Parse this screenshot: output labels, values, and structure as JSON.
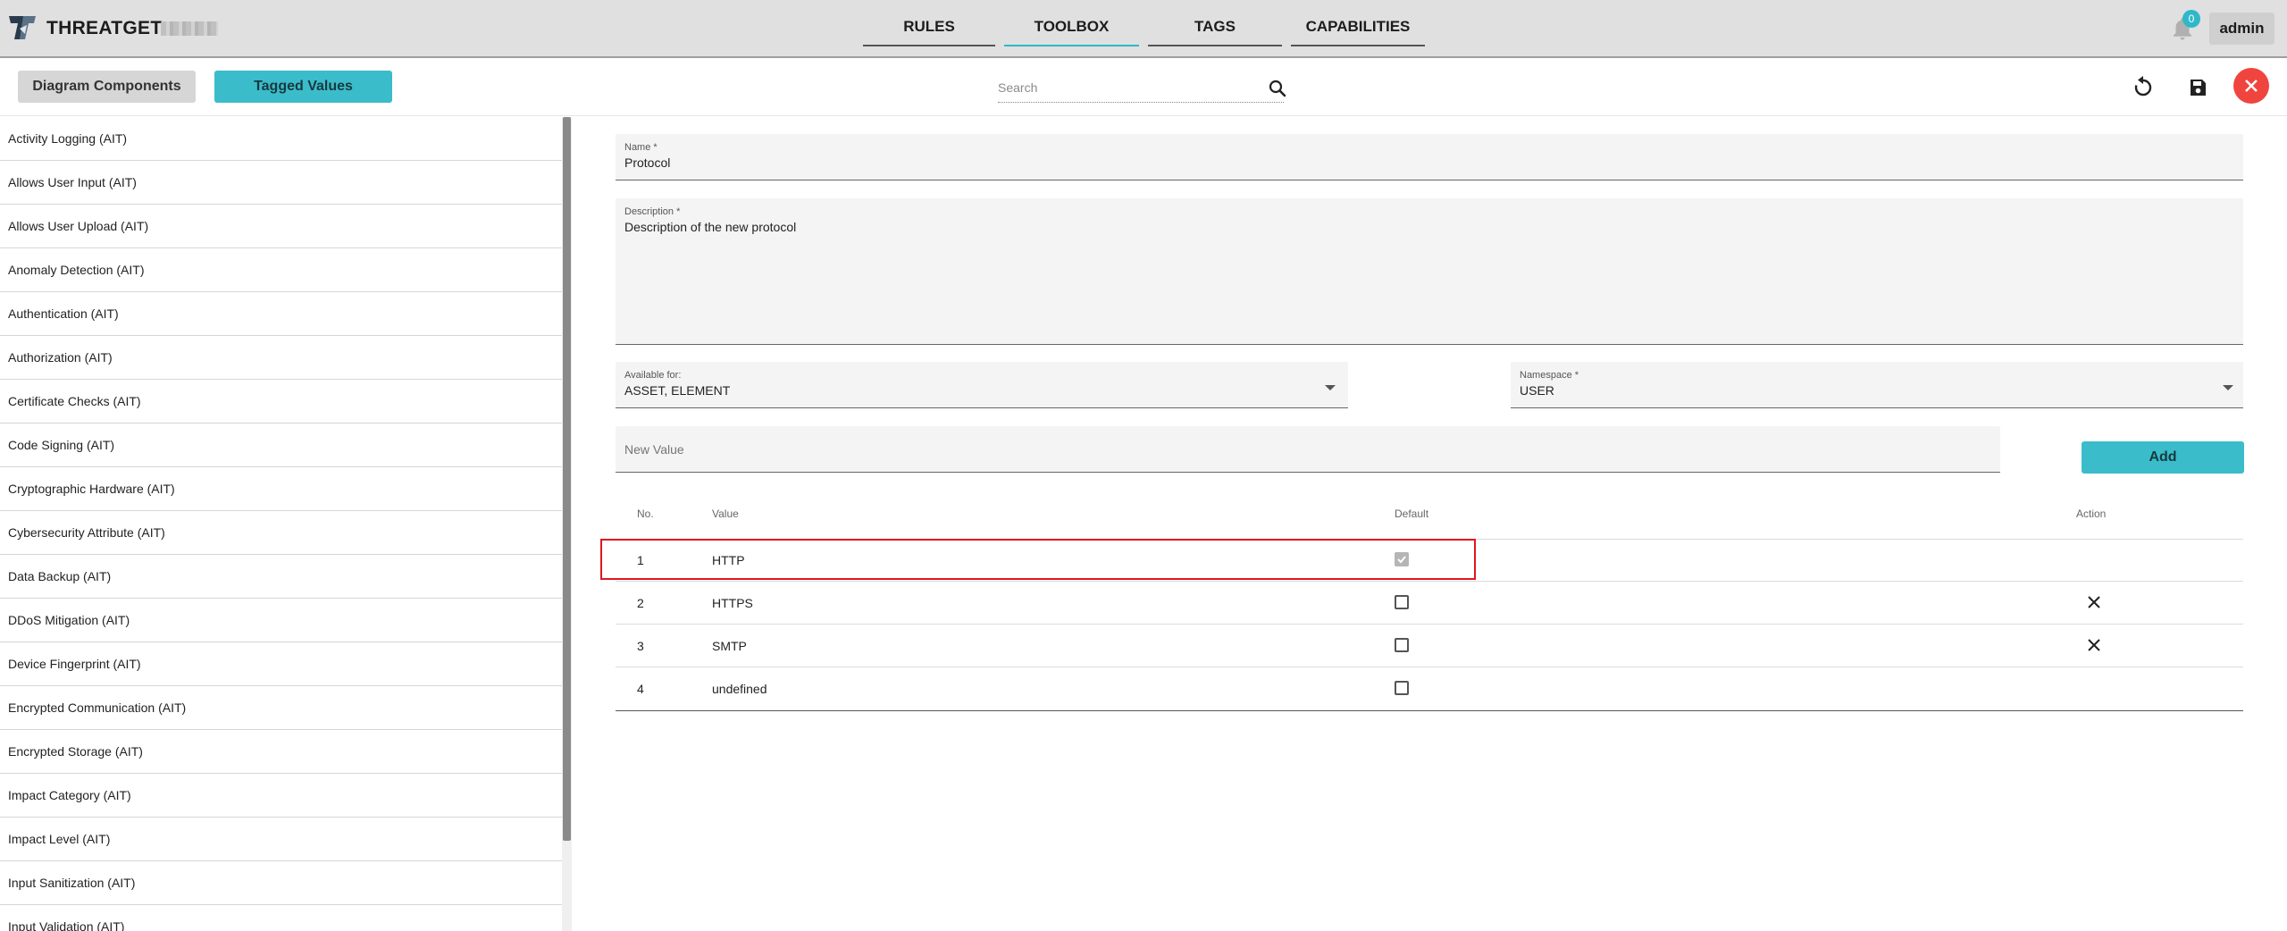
{
  "app": {
    "brand": "THREATGET",
    "notifications_count": "0",
    "user_label": "admin"
  },
  "nav": {
    "tabs": [
      {
        "label": "RULES"
      },
      {
        "label": "TOOLBOX",
        "active": true
      },
      {
        "label": "TAGS"
      },
      {
        "label": "CAPABILITIES"
      }
    ]
  },
  "toolbar": {
    "diagram_components_label": "Diagram Components",
    "tagged_values_label": "Tagged Values",
    "search_placeholder": "Search"
  },
  "sidebar": {
    "items": [
      "Activity Logging (AIT)",
      "Allows User Input (AIT)",
      "Allows User Upload (AIT)",
      "Anomaly Detection (AIT)",
      "Authentication (AIT)",
      "Authorization (AIT)",
      "Certificate Checks (AIT)",
      "Code Signing (AIT)",
      "Cryptographic Hardware (AIT)",
      "Cybersecurity Attribute (AIT)",
      "Data Backup (AIT)",
      "DDoS Mitigation (AIT)",
      "Device Fingerprint (AIT)",
      "Encrypted Communication (AIT)",
      "Encrypted Storage (AIT)",
      "Impact Category (AIT)",
      "Impact Level (AIT)",
      "Input Sanitization (AIT)",
      "Input Validation (AIT)"
    ]
  },
  "form": {
    "name": {
      "label": "Name *",
      "value": "Protocol"
    },
    "description": {
      "label": "Description *",
      "value": "Description of the new protocol"
    },
    "available_for": {
      "label": "Available for:",
      "value": "ASSET, ELEMENT"
    },
    "namespace": {
      "label": "Namespace *",
      "value": "USER"
    },
    "new_value": {
      "placeholder": "New Value"
    },
    "add_label": "Add"
  },
  "table": {
    "headers": {
      "no": "No.",
      "value": "Value",
      "default": "Default",
      "action": "Action"
    },
    "rows": [
      {
        "no": "1",
        "value": "HTTP",
        "default": true,
        "deletable": false
      },
      {
        "no": "2",
        "value": "HTTPS",
        "default": false,
        "deletable": true
      },
      {
        "no": "3",
        "value": "SMTP",
        "default": false,
        "deletable": true
      },
      {
        "no": "4",
        "value": "undefined",
        "default": false,
        "deletable": false
      }
    ]
  },
  "colors": {
    "accent": "#3bbcca",
    "close_button": "#f0443f",
    "highlight_border": "#e0161e"
  },
  "icons": {
    "logo": "threatget-logo-icon",
    "notifications": "bell-icon",
    "search": "search-icon",
    "reset": "refresh-icon",
    "save": "save-icon",
    "close": "close-icon",
    "dropdown": "caret-down-icon",
    "delete": "close-x-icon"
  }
}
